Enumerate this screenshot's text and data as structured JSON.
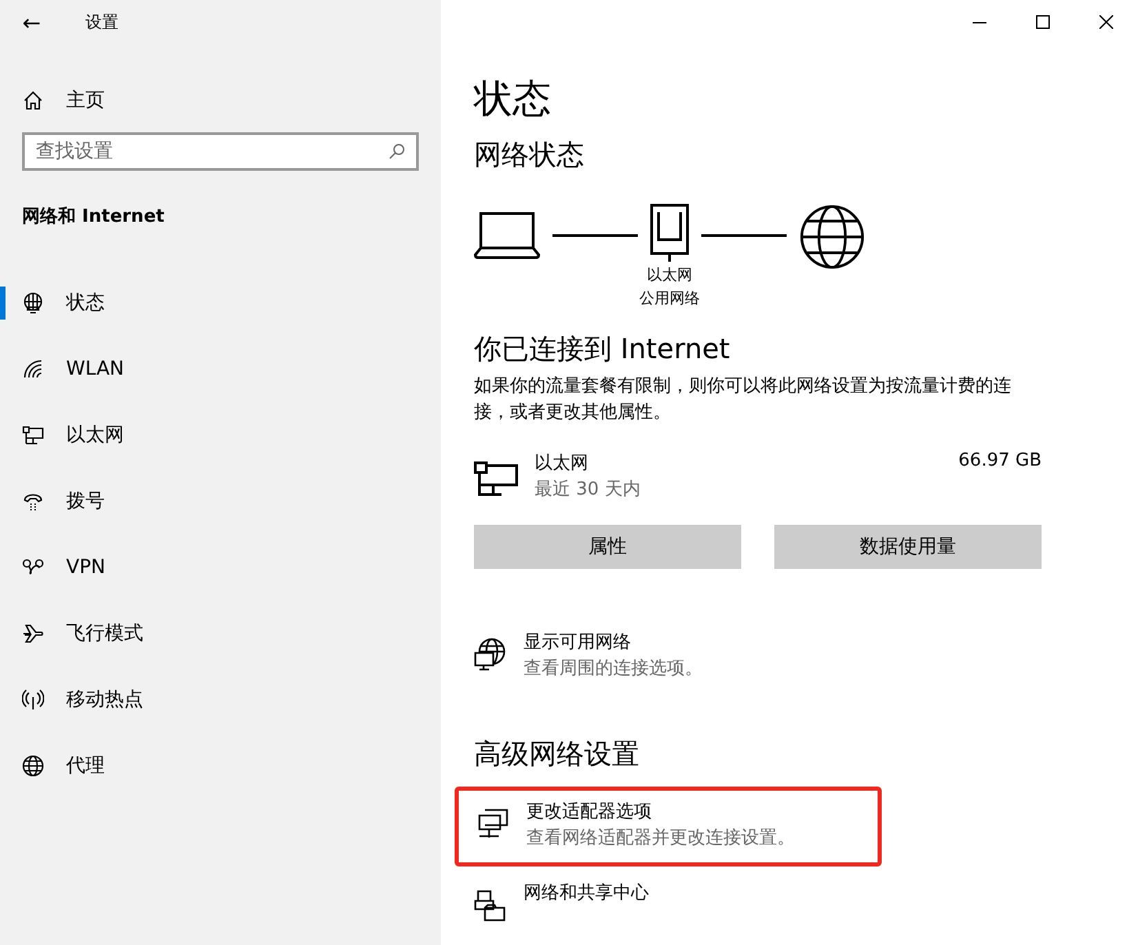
{
  "window": {
    "title": "设置",
    "back": "←"
  },
  "sidebar": {
    "home": "主页",
    "search": {
      "placeholder": "查找设置"
    },
    "section": "网络和 Internet",
    "items": [
      {
        "label": "状态",
        "kind": "status",
        "selected": true
      },
      {
        "label": "WLAN",
        "kind": "wifi",
        "selected": false
      },
      {
        "label": "以太网",
        "kind": "ethernet",
        "selected": false
      },
      {
        "label": "拨号",
        "kind": "dialup",
        "selected": false
      },
      {
        "label": "VPN",
        "kind": "vpn",
        "selected": false
      },
      {
        "label": "飞行模式",
        "kind": "airplane",
        "selected": false
      },
      {
        "label": "移动热点",
        "kind": "hotspot",
        "selected": false
      },
      {
        "label": "代理",
        "kind": "globe",
        "selected": false
      }
    ]
  },
  "page": {
    "title": "状态",
    "network_status": "网络状态",
    "diagram": {
      "adapter_name": "以太网",
      "network_type": "公用网络"
    },
    "connected_title": "你已连接到 Internet",
    "connected_desc": "如果你的流量套餐有限制，则你可以将此网络设置为按流量计费的连接，或者更改其他属性。",
    "connection": {
      "name": "以太网",
      "period": "最近 30 天内",
      "usage": "66.97 GB"
    },
    "buttons": [
      "属性",
      "数据使用量"
    ],
    "links": [
      {
        "kind": "globe",
        "title": "显示可用网络",
        "desc": "查看周围的连接选项。",
        "highlighted": false
      }
    ],
    "advanced_title": "高级网络设置",
    "advanced_links": [
      {
        "kind": "adapter",
        "title": "更改适配器选项",
        "desc": "查看网络适配器并更改连接设置。",
        "highlighted": true
      },
      {
        "kind": "sharing",
        "title": "网络和共享中心",
        "highlighted": false
      }
    ]
  }
}
